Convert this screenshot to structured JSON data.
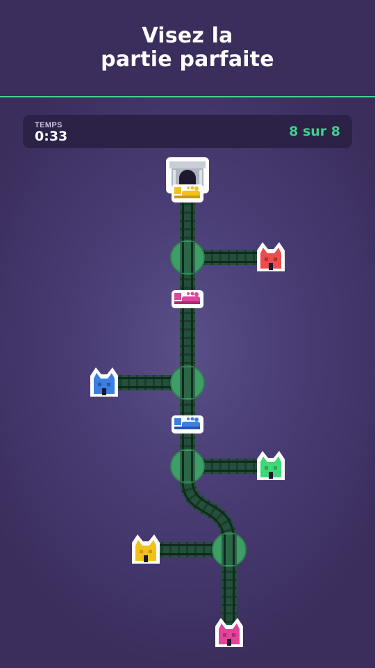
{
  "header": {
    "title_line1": "Visez la",
    "title_line2": "partie parfaite"
  },
  "stats": {
    "time_label": "TEMPS",
    "time_value": "0:33",
    "score": "8 sur 8"
  },
  "colors": {
    "accent": "#3fd38b",
    "track": "#244f3a",
    "junction": "#3f9e67",
    "house_red": "#e94d4d",
    "house_blue": "#3d7fe0",
    "house_green": "#3fd878",
    "house_yellow": "#f2c21c",
    "house_pink": "#e2449b"
  },
  "board": {
    "station": {
      "icon": "tunnel-station-icon"
    },
    "switches": [
      {
        "name": "switch-1"
      },
      {
        "name": "switch-2"
      },
      {
        "name": "switch-3"
      },
      {
        "name": "switch-4"
      }
    ],
    "houses": [
      {
        "name": "house-red",
        "color": "#e94d4d"
      },
      {
        "name": "house-blue",
        "color": "#3d7fe0"
      },
      {
        "name": "house-green",
        "color": "#3fd878"
      },
      {
        "name": "house-yellow",
        "color": "#f2c21c"
      },
      {
        "name": "house-pink",
        "color": "#e2449b"
      }
    ],
    "trains": [
      {
        "name": "train-yellow",
        "color": "#f2c21c"
      },
      {
        "name": "train-pink",
        "color": "#e2449b"
      },
      {
        "name": "train-blue",
        "color": "#3d7fe0"
      }
    ]
  }
}
